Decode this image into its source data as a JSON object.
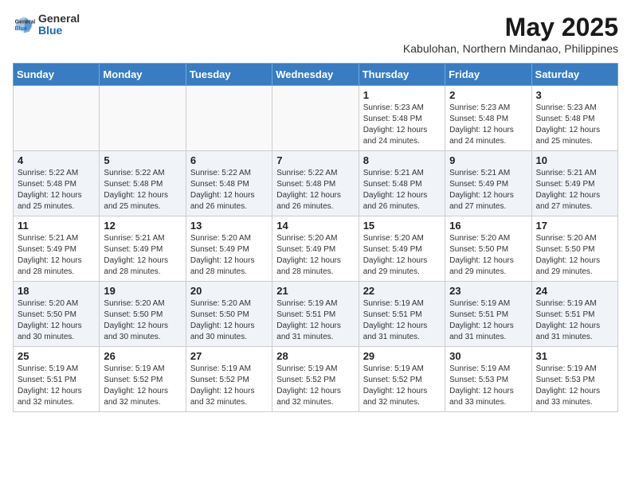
{
  "logo": {
    "general": "General",
    "blue": "Blue"
  },
  "title": "May 2025",
  "subtitle": "Kabulohan, Northern Mindanao, Philippines",
  "days_of_week": [
    "Sunday",
    "Monday",
    "Tuesday",
    "Wednesday",
    "Thursday",
    "Friday",
    "Saturday"
  ],
  "weeks": [
    [
      {
        "day": "",
        "info": ""
      },
      {
        "day": "",
        "info": ""
      },
      {
        "day": "",
        "info": ""
      },
      {
        "day": "",
        "info": ""
      },
      {
        "day": "1",
        "info": "Sunrise: 5:23 AM\nSunset: 5:48 PM\nDaylight: 12 hours\nand 24 minutes."
      },
      {
        "day": "2",
        "info": "Sunrise: 5:23 AM\nSunset: 5:48 PM\nDaylight: 12 hours\nand 24 minutes."
      },
      {
        "day": "3",
        "info": "Sunrise: 5:23 AM\nSunset: 5:48 PM\nDaylight: 12 hours\nand 25 minutes."
      }
    ],
    [
      {
        "day": "4",
        "info": "Sunrise: 5:22 AM\nSunset: 5:48 PM\nDaylight: 12 hours\nand 25 minutes."
      },
      {
        "day": "5",
        "info": "Sunrise: 5:22 AM\nSunset: 5:48 PM\nDaylight: 12 hours\nand 25 minutes."
      },
      {
        "day": "6",
        "info": "Sunrise: 5:22 AM\nSunset: 5:48 PM\nDaylight: 12 hours\nand 26 minutes."
      },
      {
        "day": "7",
        "info": "Sunrise: 5:22 AM\nSunset: 5:48 PM\nDaylight: 12 hours\nand 26 minutes."
      },
      {
        "day": "8",
        "info": "Sunrise: 5:21 AM\nSunset: 5:48 PM\nDaylight: 12 hours\nand 26 minutes."
      },
      {
        "day": "9",
        "info": "Sunrise: 5:21 AM\nSunset: 5:49 PM\nDaylight: 12 hours\nand 27 minutes."
      },
      {
        "day": "10",
        "info": "Sunrise: 5:21 AM\nSunset: 5:49 PM\nDaylight: 12 hours\nand 27 minutes."
      }
    ],
    [
      {
        "day": "11",
        "info": "Sunrise: 5:21 AM\nSunset: 5:49 PM\nDaylight: 12 hours\nand 28 minutes."
      },
      {
        "day": "12",
        "info": "Sunrise: 5:21 AM\nSunset: 5:49 PM\nDaylight: 12 hours\nand 28 minutes."
      },
      {
        "day": "13",
        "info": "Sunrise: 5:20 AM\nSunset: 5:49 PM\nDaylight: 12 hours\nand 28 minutes."
      },
      {
        "day": "14",
        "info": "Sunrise: 5:20 AM\nSunset: 5:49 PM\nDaylight: 12 hours\nand 28 minutes."
      },
      {
        "day": "15",
        "info": "Sunrise: 5:20 AM\nSunset: 5:49 PM\nDaylight: 12 hours\nand 29 minutes."
      },
      {
        "day": "16",
        "info": "Sunrise: 5:20 AM\nSunset: 5:50 PM\nDaylight: 12 hours\nand 29 minutes."
      },
      {
        "day": "17",
        "info": "Sunrise: 5:20 AM\nSunset: 5:50 PM\nDaylight: 12 hours\nand 29 minutes."
      }
    ],
    [
      {
        "day": "18",
        "info": "Sunrise: 5:20 AM\nSunset: 5:50 PM\nDaylight: 12 hours\nand 30 minutes."
      },
      {
        "day": "19",
        "info": "Sunrise: 5:20 AM\nSunset: 5:50 PM\nDaylight: 12 hours\nand 30 minutes."
      },
      {
        "day": "20",
        "info": "Sunrise: 5:20 AM\nSunset: 5:50 PM\nDaylight: 12 hours\nand 30 minutes."
      },
      {
        "day": "21",
        "info": "Sunrise: 5:19 AM\nSunset: 5:51 PM\nDaylight: 12 hours\nand 31 minutes."
      },
      {
        "day": "22",
        "info": "Sunrise: 5:19 AM\nSunset: 5:51 PM\nDaylight: 12 hours\nand 31 minutes."
      },
      {
        "day": "23",
        "info": "Sunrise: 5:19 AM\nSunset: 5:51 PM\nDaylight: 12 hours\nand 31 minutes."
      },
      {
        "day": "24",
        "info": "Sunrise: 5:19 AM\nSunset: 5:51 PM\nDaylight: 12 hours\nand 31 minutes."
      }
    ],
    [
      {
        "day": "25",
        "info": "Sunrise: 5:19 AM\nSunset: 5:51 PM\nDaylight: 12 hours\nand 32 minutes."
      },
      {
        "day": "26",
        "info": "Sunrise: 5:19 AM\nSunset: 5:52 PM\nDaylight: 12 hours\nand 32 minutes."
      },
      {
        "day": "27",
        "info": "Sunrise: 5:19 AM\nSunset: 5:52 PM\nDaylight: 12 hours\nand 32 minutes."
      },
      {
        "day": "28",
        "info": "Sunrise: 5:19 AM\nSunset: 5:52 PM\nDaylight: 12 hours\nand 32 minutes."
      },
      {
        "day": "29",
        "info": "Sunrise: 5:19 AM\nSunset: 5:52 PM\nDaylight: 12 hours\nand 32 minutes."
      },
      {
        "day": "30",
        "info": "Sunrise: 5:19 AM\nSunset: 5:53 PM\nDaylight: 12 hours\nand 33 minutes."
      },
      {
        "day": "31",
        "info": "Sunrise: 5:19 AM\nSunset: 5:53 PM\nDaylight: 12 hours\nand 33 minutes."
      }
    ]
  ]
}
